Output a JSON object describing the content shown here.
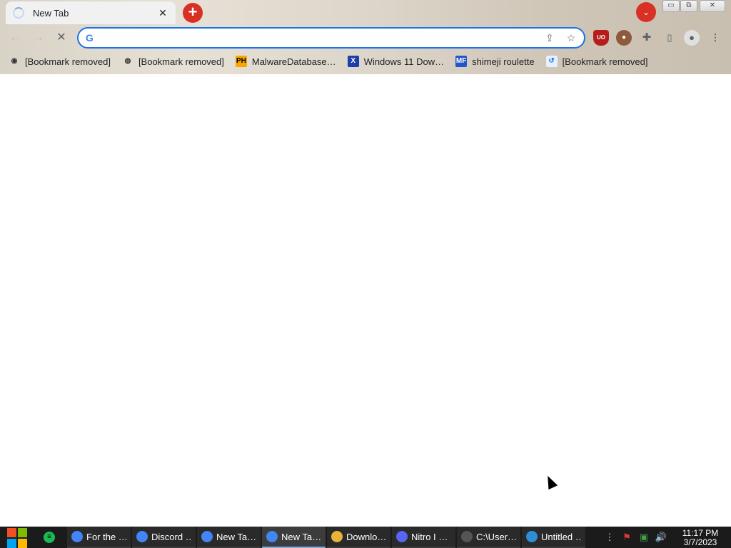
{
  "browser": {
    "tab": {
      "title": "New Tab",
      "close": "✕"
    },
    "new_tab_symbol": "+",
    "tab_search_symbol": "⌄",
    "window_controls": {
      "minimize": "▭",
      "restore": "⧉",
      "close": "✕"
    },
    "nav": {
      "back": "←",
      "forward": "→",
      "stop": "✕"
    },
    "omnibox": {
      "value": "",
      "placeholder": "",
      "google_glyph": "G",
      "share_icon": "⇪",
      "star_icon": "☆"
    },
    "extensions": {
      "ublock_label": "UO",
      "menu": "⋮"
    },
    "bookmarks": [
      {
        "label": "[Bookmark removed]",
        "icon": "github-icon",
        "glyph": "◉",
        "icon_bg": "transparent",
        "icon_fg": "#333333"
      },
      {
        "label": "[Bookmark removed]",
        "icon": "globe-icon",
        "glyph": "◍",
        "icon_bg": "transparent",
        "icon_fg": "#333333"
      },
      {
        "label": "MalwareDatabase…",
        "icon": "ph-icon",
        "glyph": "PH",
        "icon_bg": "#f7a600",
        "icon_fg": "#000000"
      },
      {
        "label": "Windows 11 Dow…",
        "icon": "x-icon",
        "glyph": "X",
        "icon_bg": "#1d3fa8",
        "icon_fg": "#ffffff"
      },
      {
        "label": "shimeji roulette",
        "icon": "mft-icon",
        "glyph": "MF",
        "icon_bg": "#2256c9",
        "icon_fg": "#ffffff"
      },
      {
        "label": "[Bookmark removed]",
        "icon": "page-icon",
        "glyph": "↺",
        "icon_bg": "#e8f0fe",
        "icon_fg": "#1a73e8"
      }
    ]
  },
  "taskbar": {
    "quick_launch_icon": "spotify-icon",
    "tasks": [
      {
        "label": "For the …",
        "icon": "chrome-icon",
        "icon_color": "#4285f4",
        "active": false
      },
      {
        "label": "Discord …",
        "icon": "chrome-icon",
        "icon_color": "#4285f4",
        "active": false
      },
      {
        "label": "New Ta…",
        "icon": "chrome-icon",
        "icon_color": "#4285f4",
        "active": false
      },
      {
        "label": "New Ta…",
        "icon": "chrome-icon",
        "icon_color": "#4285f4",
        "active": true
      },
      {
        "label": "Downlo…",
        "icon": "folder-icon",
        "icon_color": "#e8b339",
        "active": false
      },
      {
        "label": "Nitro I …",
        "icon": "discord-icon",
        "icon_color": "#5865f2",
        "active": false
      },
      {
        "label": "C:\\User…",
        "icon": "seven-zip-icon",
        "icon_color": "#555555",
        "active": false
      },
      {
        "label": "Untitled …",
        "icon": "paint-icon",
        "icon_color": "#2d8ed8",
        "active": false
      }
    ],
    "tray": {
      "overflow": "⋮",
      "flag": "⚑",
      "network": "▣",
      "volume": "🔊"
    },
    "clock": {
      "time": "11:17 PM",
      "date": "3/7/2023"
    }
  },
  "colors": {
    "accent": "#1a73e8",
    "chrome_red": "#d93025"
  }
}
